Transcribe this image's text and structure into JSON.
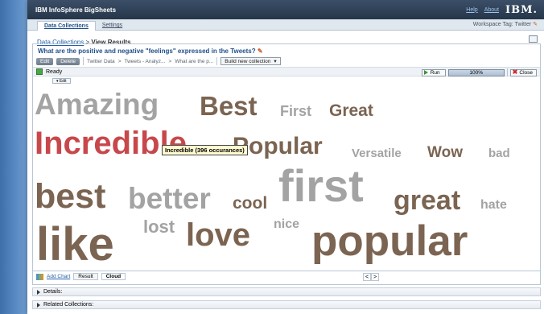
{
  "app": {
    "title": "IBM InfoSphere BigSheets",
    "help": "Help",
    "about": "About",
    "brand": "IBM."
  },
  "tabs": [
    {
      "label": "Data Collections"
    },
    {
      "label": "Settings"
    }
  ],
  "workspace_tag": "Workspace Tag: Twitter",
  "breadcrumb": {
    "parent": "Data Collections",
    "separator": ">",
    "current": "View Results"
  },
  "panel": {
    "title": "What are the positive and negative \"feelings\" expressed in the Tweets?",
    "edit_label": "Edit",
    "delete_label": "Delete",
    "path": [
      "Twitter Data",
      "Tweets - Analyz...",
      "What are the p..."
    ],
    "path_separator": ">",
    "build_label": "Build new collection"
  },
  "status": {
    "text": "Ready",
    "run_label": "Run",
    "progress_percent": 100,
    "progress_text": "100%",
    "close_label": "Close"
  },
  "cloud": {
    "edit_tab": "Edit",
    "tooltip": "Incredible (396 occurances)",
    "colors": {
      "gray": "#a3a3a3",
      "brown": "#7b6451",
      "red": "#c7484b"
    },
    "words": [
      {
        "text": "Amazing",
        "color": "gray"
      },
      {
        "text": "Best",
        "color": "brown"
      },
      {
        "text": "First",
        "color": "gray"
      },
      {
        "text": "Great",
        "color": "brown"
      },
      {
        "text": "Incredible",
        "color": "red"
      },
      {
        "text": "Popular",
        "color": "brown"
      },
      {
        "text": "Versatile",
        "color": "gray"
      },
      {
        "text": "Wow",
        "color": "brown"
      },
      {
        "text": "bad",
        "color": "gray"
      },
      {
        "text": "best",
        "color": "brown"
      },
      {
        "text": "better",
        "color": "gray"
      },
      {
        "text": "cool",
        "color": "brown"
      },
      {
        "text": "first",
        "color": "gray"
      },
      {
        "text": "great",
        "color": "brown"
      },
      {
        "text": "hate",
        "color": "gray"
      },
      {
        "text": "lost",
        "color": "gray"
      },
      {
        "text": "nice",
        "color": "gray"
      },
      {
        "text": "like",
        "color": "brown"
      },
      {
        "text": "love",
        "color": "brown"
      },
      {
        "text": "popular",
        "color": "brown"
      }
    ]
  },
  "bottom": {
    "add_chart": "Add Chart",
    "result_tab": "Result",
    "cloud_tab": "Cloud",
    "prev": "<",
    "next": ">"
  },
  "sections": {
    "details": "Details:",
    "related": "Related Collections:"
  }
}
